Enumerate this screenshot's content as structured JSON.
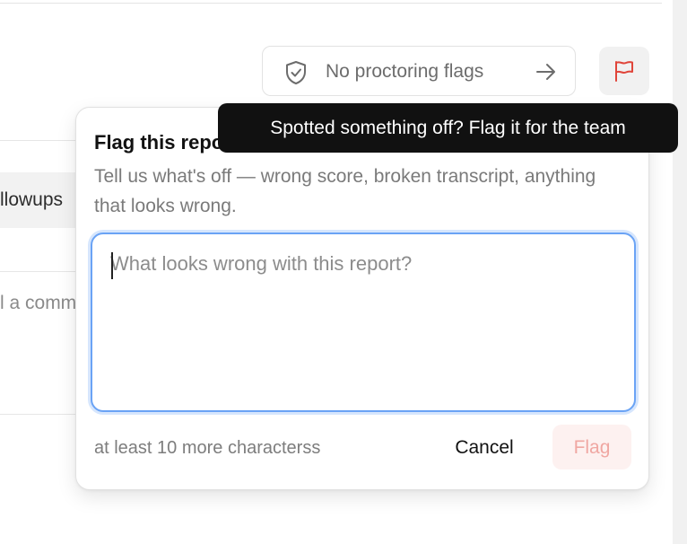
{
  "background": {
    "chip_text": "llowups",
    "comment_text": "l a comm"
  },
  "proctoring": {
    "label": "No proctoring flags",
    "icon": "shield-check-icon",
    "arrow_icon": "arrow-right-icon"
  },
  "flag_button": {
    "icon": "flag-icon",
    "color": "#e0453a"
  },
  "tooltip": {
    "text": "Spotted something off? Flag it for the team"
  },
  "popover": {
    "title": "Flag this report",
    "description": "Tell us what's off — wrong score, broken transcript, anything that looks wrong.",
    "textarea": {
      "placeholder": "What looks wrong with this report?",
      "value": ""
    },
    "counter": "at least 10 more characterss",
    "cancel_label": "Cancel",
    "submit_label": "Flag"
  },
  "colors": {
    "focus_ring": "#6aa3f5",
    "submit_bg": "#fdf1f0",
    "submit_text": "#f0a7a2",
    "tooltip_bg": "#111111"
  }
}
